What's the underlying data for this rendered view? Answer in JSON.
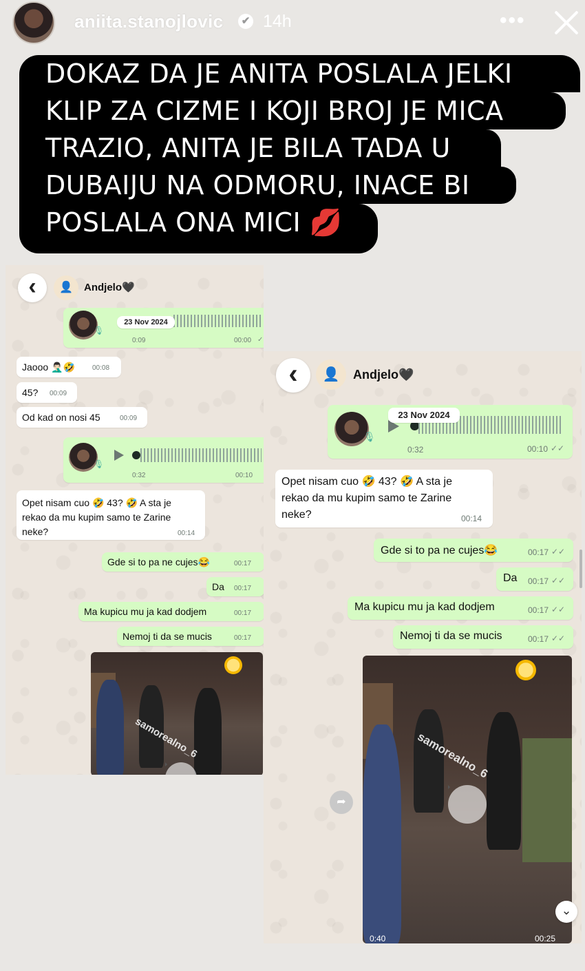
{
  "story": {
    "username": "aniita.stanojlovic",
    "verified_mark": "✔",
    "time": "14h",
    "more_label": "•••",
    "icons": [
      "avatar",
      "verified-badge-icon",
      "more-icon",
      "close-icon"
    ]
  },
  "caption": {
    "lines": [
      "DOKAZ DA JE ANITA POSLALA JELKI",
      "KLIP ZA CIZME I KOJI BROJ JE MICA",
      "TRAZIO, ANITA JE BILA TADA U",
      "DUBAIJU NA ODMORU, INACE BI",
      "POSLALA ONA MICI 💋"
    ]
  },
  "left_chat": {
    "contact": "Andjelo🖤",
    "date": "23 Nov 2024",
    "voice1": {
      "duration": "0:09",
      "time": "00:00"
    },
    "messages_in": [
      {
        "text": "Jaooo 🤦🏻‍♂️🤣",
        "time": "00:08"
      },
      {
        "text": "45?",
        "time": "00:09"
      },
      {
        "text": "Od kad on nosi 45",
        "time": "00:09"
      }
    ],
    "voice2": {
      "duration": "0:32",
      "time": "00:10"
    },
    "long_in": {
      "line1": "Opet nisam cuo 🤣 43? 🤣 A sta je",
      "line2": "rekao da mu kupim samo te Zarine",
      "line3": "neke?",
      "time": "00:14"
    },
    "messages_out": [
      {
        "text": "Gde si to pa ne cujes😂",
        "time": "00:17"
      },
      {
        "text": "Da",
        "time": "00:17"
      },
      {
        "text": "Ma kupicu mu ja kad dodjem",
        "time": "00:17"
      },
      {
        "text": "Nemoj ti da se mucis",
        "time": "00:17"
      }
    ],
    "watermark": "samorealno_6"
  },
  "right_chat": {
    "contact": "Andjelo🖤",
    "date": "23 Nov 2024",
    "voice": {
      "duration": "0:32",
      "time": "00:10"
    },
    "long_in": {
      "line1": "Opet nisam cuo 🤣 43? 🤣 A sta je",
      "line2": "rekao da mu kupim samo te Zarine",
      "line3": "neke?",
      "time": "00:14"
    },
    "messages_out": [
      {
        "text": "Gde si to pa ne cujes😂",
        "time": "00:17"
      },
      {
        "text": "Da",
        "time": "00:17"
      },
      {
        "text": "Ma kupicu mu ja kad dodjem",
        "time": "00:17"
      },
      {
        "text": "Nemoj ti da se mucis",
        "time": "00:17"
      }
    ],
    "watermark": "samorealno_6",
    "video_duration": "0:40",
    "video_time": "00:25"
  },
  "ticks": "✓✓",
  "back_glyph": "‹",
  "person_glyph": "👤",
  "forward_glyph": "➦",
  "down_glyph": "⌄"
}
